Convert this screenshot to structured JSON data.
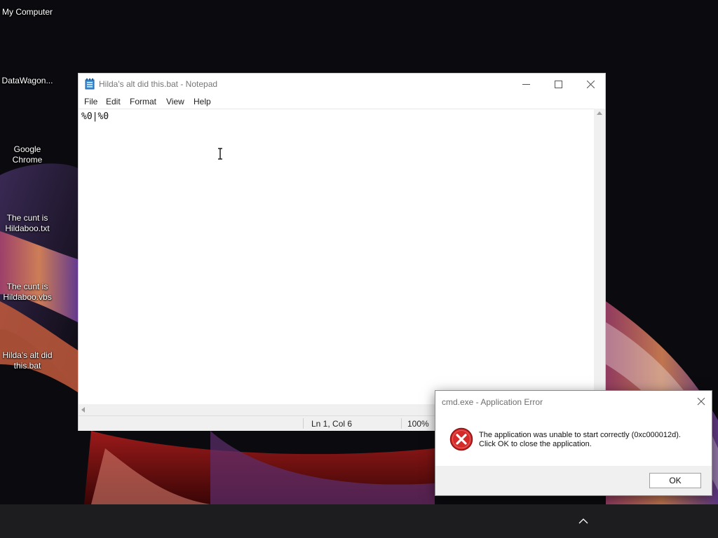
{
  "desktop": {
    "icons": [
      {
        "label_lines": [
          "My Computer"
        ]
      },
      {
        "label_lines": [
          "DataWagon..."
        ]
      },
      {
        "label_lines": [
          "Google",
          "Chrome"
        ]
      },
      {
        "label_lines": [
          "The cunt is",
          "Hildaboo.txt"
        ]
      },
      {
        "label_lines": [
          "The cunt is",
          "Hildaboo.vbs"
        ]
      },
      {
        "label_lines": [
          "Hilda's alt did",
          "this.bat"
        ]
      }
    ]
  },
  "notepad": {
    "title": "Hilda's alt did this.bat - Notepad",
    "menu": [
      "File",
      "Edit",
      "Format",
      "View",
      "Help"
    ],
    "content": "%0|%0",
    "status": {
      "position": "Ln 1, Col 6",
      "zoom": "100%"
    },
    "icon": "notepad-icon"
  },
  "error_dialog": {
    "title": "cmd.exe - Application Error",
    "message_lines": [
      "The application was unable to start correctly (0xc000012d).",
      "Click OK to close the application."
    ],
    "ok_label": "OK",
    "icon": "error-icon",
    "accent": "#d42a2a"
  },
  "taskbar": {
    "tray_icon": "chevron-up-icon"
  }
}
